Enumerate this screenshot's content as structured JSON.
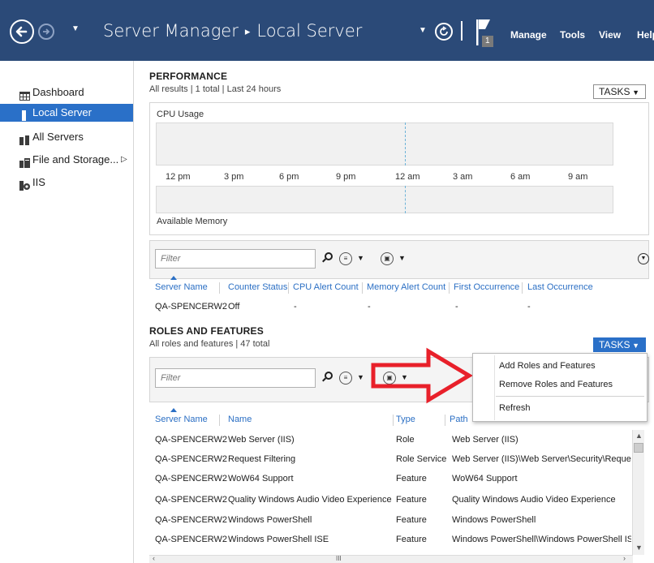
{
  "header": {
    "title_app": "Server Manager",
    "title_page": "Local Server",
    "flag_count": "1",
    "menus": [
      "Manage",
      "Tools",
      "View",
      "Help"
    ],
    "back_icon": "back-arrow-icon",
    "forward_icon": "forward-arrow-icon",
    "refresh_icon": "refresh-icon",
    "flag_icon": "notifications-flag-icon",
    "colors": {
      "bar": "#2b4a78",
      "accent": "#2a70c8"
    }
  },
  "sidebar": {
    "items": [
      {
        "label": "Dashboard",
        "icon": "dashboard-icon"
      },
      {
        "label": "Local Server",
        "icon": "local-server-icon",
        "active": true
      },
      {
        "label": "All Servers",
        "icon": "all-servers-icon"
      },
      {
        "label": "File and Storage...",
        "icon": "file-storage-icon"
      },
      {
        "label": "IIS",
        "icon": "iis-icon"
      }
    ]
  },
  "performance": {
    "title": "PERFORMANCE",
    "subtitle": "All results | 1 total  |  Last 24 hours",
    "tasks": "TASKS",
    "cpu_label": "CPU Usage",
    "memory_label": "Available Memory",
    "ticks": [
      "12 pm",
      "3 pm",
      "6 pm",
      "9 pm",
      "12 am",
      "3 am",
      "6 am",
      "9 am"
    ],
    "filter_placeholder": "Filter",
    "columns": [
      "Server Name",
      "Counter Status",
      "CPU Alert Count",
      "Memory Alert Count",
      "First Occurrence",
      "Last Occurrence"
    ],
    "rows": [
      [
        "QA-SPENCERW2",
        "Off",
        "-",
        "-",
        "-",
        "-"
      ]
    ]
  },
  "roles": {
    "title": "ROLES AND FEATURES",
    "subtitle": "All roles and features | 47 total",
    "tasks": "TASKS",
    "filter_placeholder": "Filter",
    "columns": [
      "Server Name",
      "Name",
      "Type",
      "Path"
    ],
    "rows": [
      [
        "QA-SPENCERW2",
        "Web Server (IIS)",
        "Role",
        "Web Server (IIS)"
      ],
      [
        "QA-SPENCERW2",
        "Request Filtering",
        "Role Service",
        "Web Server (IIS)\\Web Server\\Security\\Request"
      ],
      [
        "QA-SPENCERW2",
        "WoW64 Support",
        "Feature",
        "WoW64 Support"
      ],
      [
        "QA-SPENCERW2",
        "Quality Windows Audio Video Experience",
        "Feature",
        "Quality Windows Audio Video Experience"
      ],
      [
        "QA-SPENCERW2",
        "Windows PowerShell",
        "Feature",
        "Windows PowerShell"
      ],
      [
        "QA-SPENCERW2",
        "Windows PowerShell ISE",
        "Feature",
        "Windows PowerShell\\Windows PowerShell ISE"
      ]
    ],
    "hscroll_thumb": "III"
  },
  "tasks_menu": {
    "items": [
      "Add Roles and Features",
      "Remove Roles and Features",
      "Refresh"
    ]
  },
  "annotation": {
    "arrow_color": "#e8202a"
  }
}
